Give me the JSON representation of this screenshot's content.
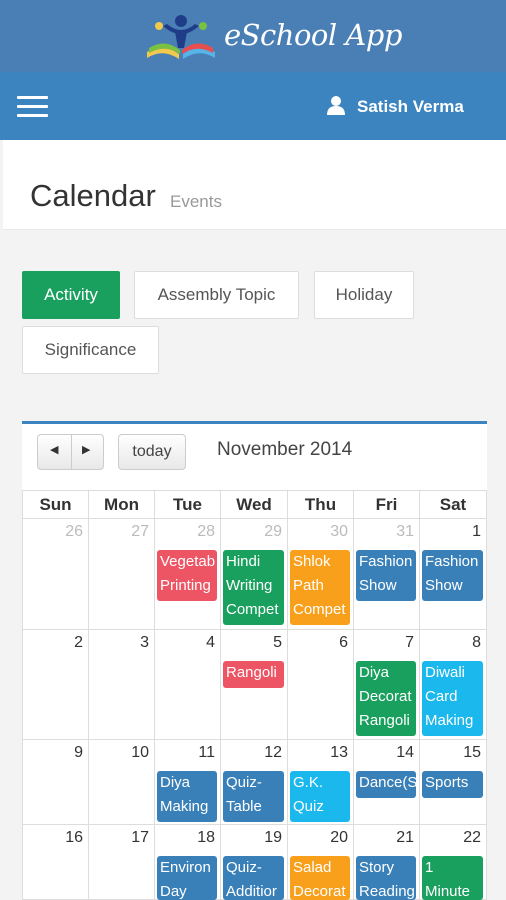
{
  "header": {
    "brand": "eSchool App",
    "user_name": "Satish Verma"
  },
  "page": {
    "title": "Calendar",
    "subtitle": "Events"
  },
  "filters": [
    "Activity",
    "Assembly Topic",
    "Holiday",
    "Significance"
  ],
  "calendar": {
    "month_title": "November 2014",
    "today_label": "today",
    "prev_symbol": "◀",
    "next_symbol": "▶",
    "days_of_week": [
      "Sun",
      "Mon",
      "Tue",
      "Wed",
      "Thu",
      "Fri",
      "Sat"
    ],
    "weeks": [
      [
        "26",
        "27",
        "28",
        "29",
        "30",
        "31",
        "1"
      ],
      [
        "2",
        "3",
        "4",
        "5",
        "6",
        "7",
        "8"
      ],
      [
        "9",
        "10",
        "11",
        "12",
        "13",
        "14",
        "15"
      ],
      [
        "16",
        "17",
        "18",
        "19",
        "20",
        "21",
        "22"
      ]
    ],
    "events": [
      {
        "week": 0,
        "day": 2,
        "text": "Vegetab\nPrinting",
        "color": "#ed5565"
      },
      {
        "week": 0,
        "day": 3,
        "text": "Hindi\nWriting\nCompet",
        "color": "#1aa05e"
      },
      {
        "week": 0,
        "day": 4,
        "text": "Shlok\nPath\nCompet",
        "color": "#f8a01c"
      },
      {
        "week": 0,
        "day": 5,
        "text": "Fashion\nShow",
        "color": "#3a80b8"
      },
      {
        "week": 0,
        "day": 6,
        "text": "Fashion\nShow",
        "color": "#3a80b8"
      },
      {
        "week": 1,
        "day": 3,
        "text": "Rangoli",
        "color": "#ed5565"
      },
      {
        "week": 1,
        "day": 5,
        "text": "Diya\nDecorat\nRangoli",
        "color": "#1aa05e"
      },
      {
        "week": 1,
        "day": 6,
        "text": "Diwali\nCard\nMaking",
        "color": "#1ab8ec"
      },
      {
        "week": 2,
        "day": 2,
        "text": "Diya\nMaking",
        "color": "#3a80b8"
      },
      {
        "week": 2,
        "day": 3,
        "text": "Quiz-\nTable",
        "color": "#3a80b8"
      },
      {
        "week": 2,
        "day": 4,
        "text": "G.K.\nQuiz",
        "color": "#1ab8ec"
      },
      {
        "week": 2,
        "day": 5,
        "text": "Dance(S",
        "color": "#3a80b8"
      },
      {
        "week": 2,
        "day": 6,
        "text": "Sports",
        "color": "#3a80b8"
      },
      {
        "week": 3,
        "day": 2,
        "text": "Environ\nDay",
        "color": "#3a80b8"
      },
      {
        "week": 3,
        "day": 3,
        "text": "Quiz-\nAdditior",
        "color": "#3a80b8"
      },
      {
        "week": 3,
        "day": 4,
        "text": "Salad\nDecorat",
        "color": "#f8a01c"
      },
      {
        "week": 3,
        "day": 5,
        "text": "Story\nReading",
        "color": "#3a80b8"
      },
      {
        "week": 3,
        "day": 6,
        "text": "1\nMinute",
        "color": "#1aa05e"
      }
    ]
  }
}
